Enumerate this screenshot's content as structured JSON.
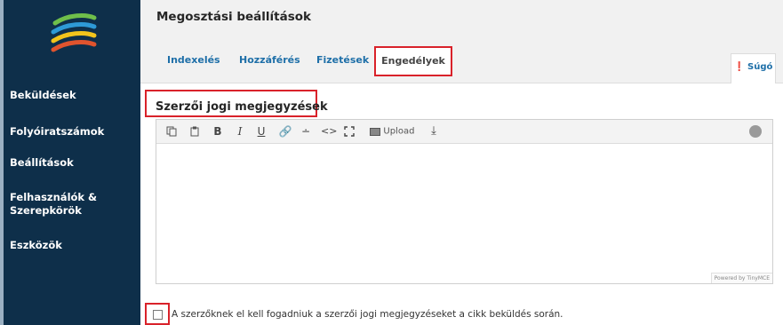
{
  "sidebar": {
    "items": [
      {
        "label": "Beküldések"
      },
      {
        "label": "Folyóiratszámok"
      },
      {
        "label": "Beállítások"
      },
      {
        "label": "Felhasználók &"
      },
      {
        "label": "Szerepkörök"
      },
      {
        "label": "Eszközök"
      }
    ]
  },
  "header": {
    "title": "Megosztási beállítások",
    "tabs": [
      {
        "label": "Indexelés"
      },
      {
        "label": "Hozzáférés"
      },
      {
        "label": "Fizetések"
      },
      {
        "label": "Engedélyek"
      }
    ],
    "active_tab": "Engedélyek",
    "help_label": "Súgó"
  },
  "content": {
    "field_label": "Szerzői jogi megjegyzések",
    "editor": {
      "upload_label": "Upload",
      "powered_by": "Powered by TinyMCE"
    },
    "checkbox_label": "A szerzőknek el kell fogadniuk a szerzői jogi megjegyzéseket a cikk beküldés során.",
    "checkbox_checked": false
  },
  "colors": {
    "sidebar_bg": "#0e2f4a",
    "link": "#1e6fa8",
    "highlight": "#d9222a"
  }
}
